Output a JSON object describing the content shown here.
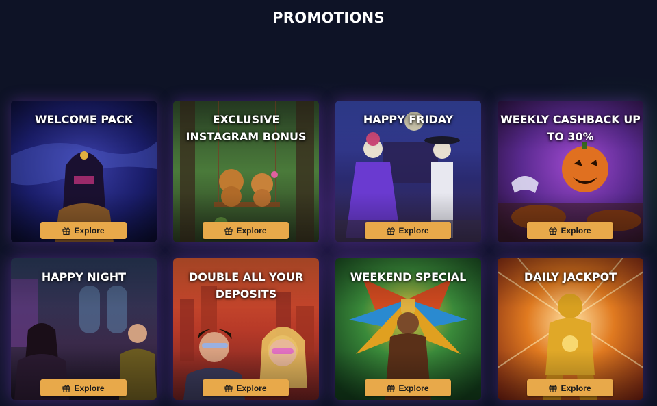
{
  "page": {
    "title": "PROMOTIONS"
  },
  "promotions": [
    {
      "title": "WELCOME PACK",
      "button_label": "Explore",
      "icon": "gift-icon"
    },
    {
      "title": "EXCLUSIVE INSTAGRAM BONUS",
      "button_label": "Explore",
      "icon": "gift-icon"
    },
    {
      "title": "HAPPY FRIDAY",
      "button_label": "Explore",
      "icon": "gift-icon"
    },
    {
      "title": "WEEKLY CASHBACK UP TO 30%",
      "button_label": "Explore",
      "icon": "gift-icon"
    },
    {
      "title": "HAPPY NIGHT",
      "button_label": "Explore",
      "icon": "gift-icon"
    },
    {
      "title": "DOUBLE ALL YOUR DEPOSITS",
      "button_label": "Explore",
      "icon": "gift-icon"
    },
    {
      "title": "WEEKEND SPECIAL",
      "button_label": "Explore",
      "icon": "gift-icon"
    },
    {
      "title": "DAILY JACKPOT",
      "button_label": "Explore",
      "icon": "gift-icon"
    }
  ],
  "colors": {
    "background": "#0e1326",
    "button": "#e8a94a",
    "button_text": "#1b1b1b"
  }
}
